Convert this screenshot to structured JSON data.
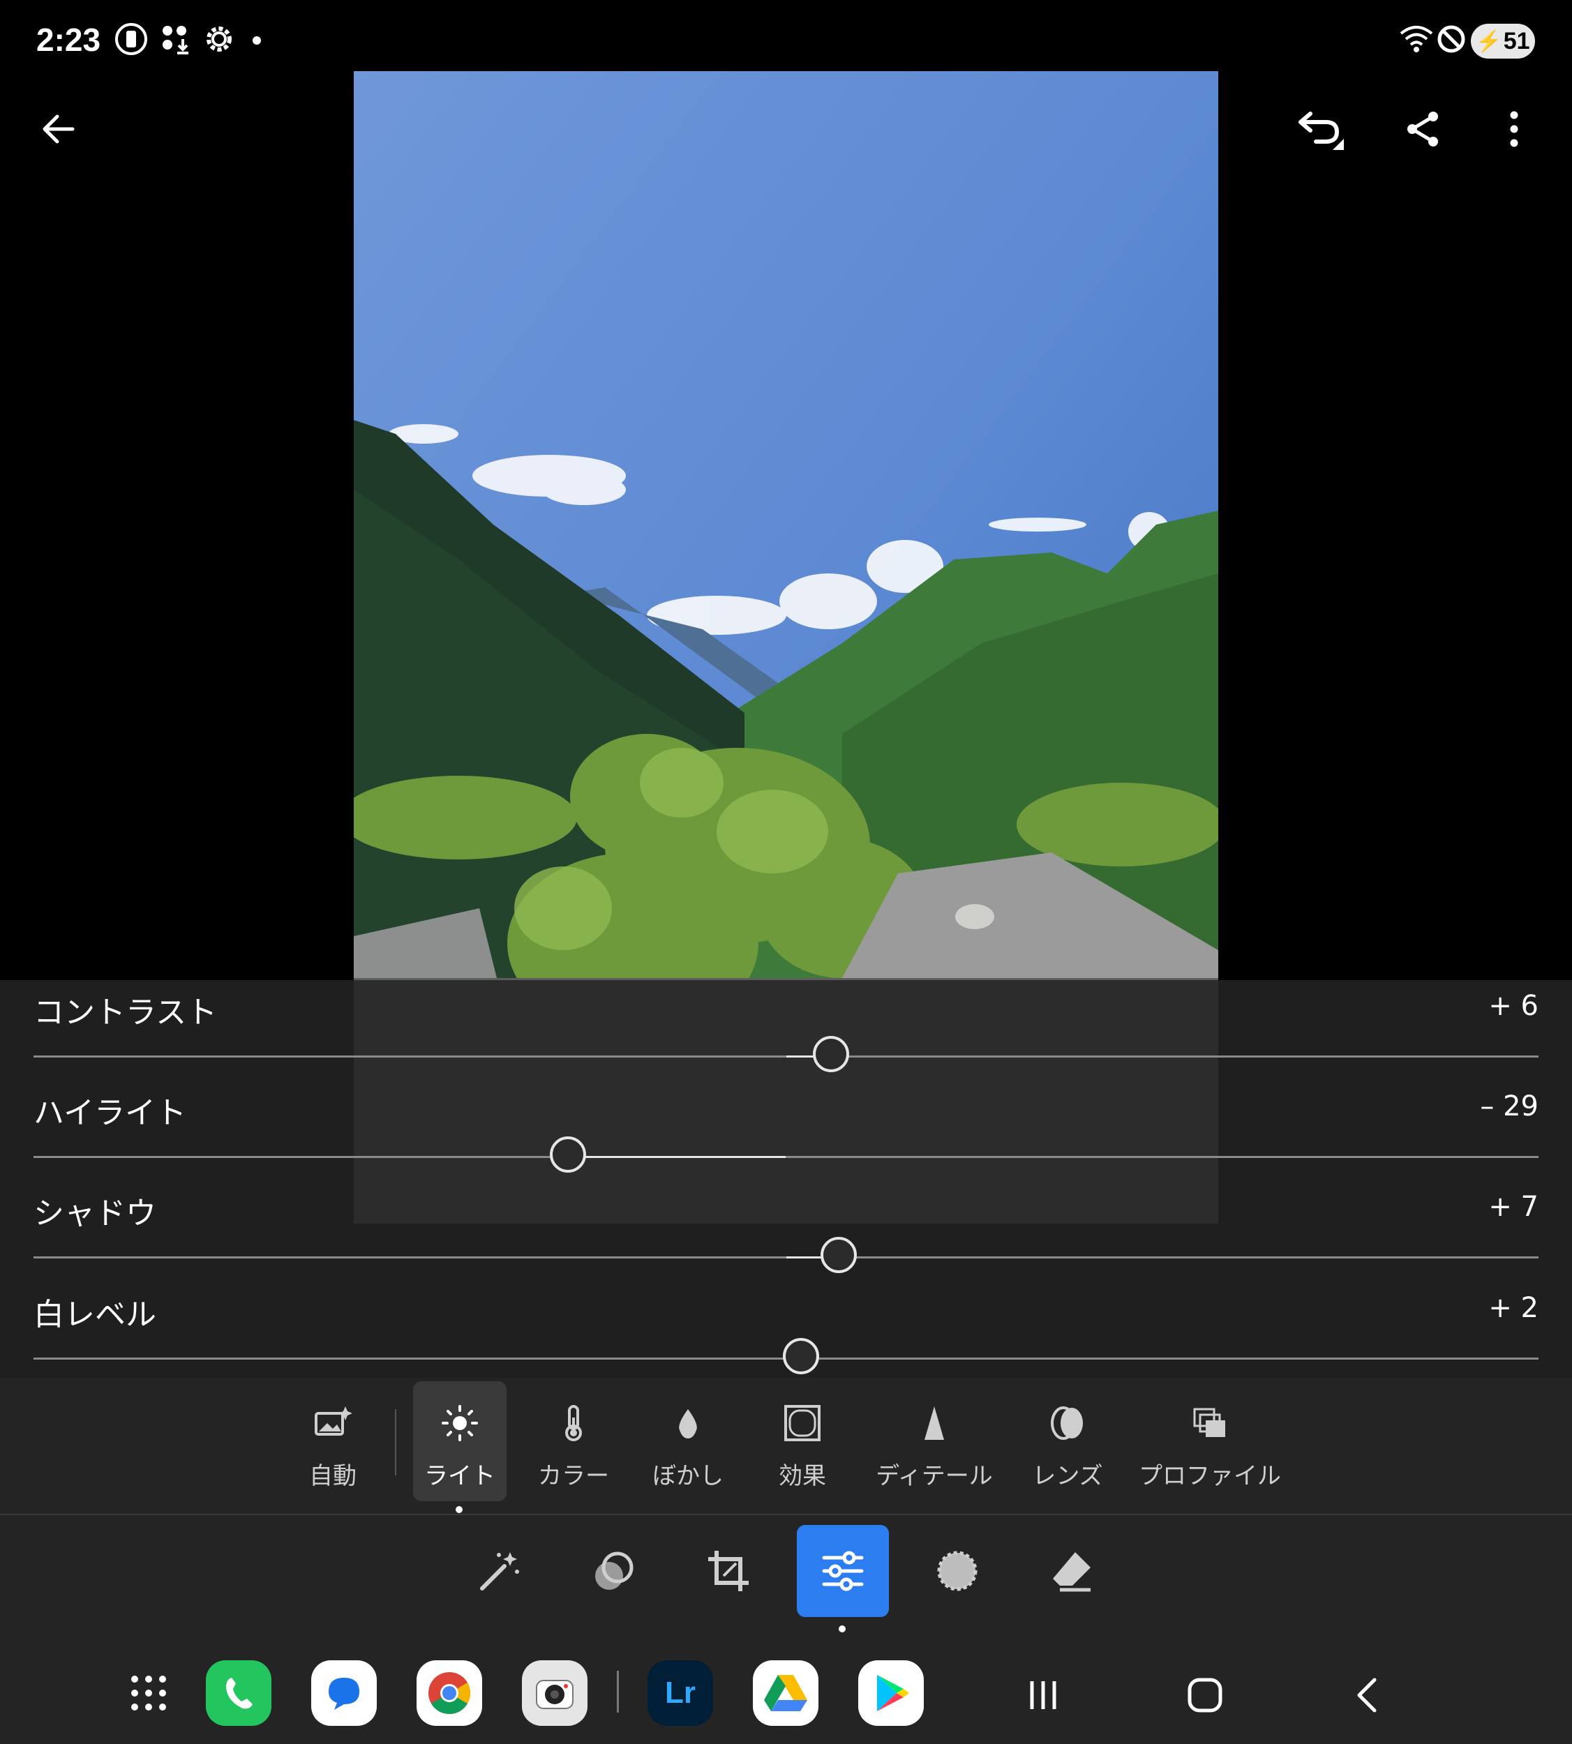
{
  "status_bar": {
    "time": "2:23",
    "battery": "51"
  },
  "photo": {
    "alt": "mountain river landscape"
  },
  "sliders": [
    {
      "label": "コントラスト",
      "value": "+ 6",
      "amount": 6
    },
    {
      "label": "ハイライト",
      "value": "– 29",
      "amount": -29
    },
    {
      "label": "シャドウ",
      "value": "+ 7",
      "amount": 7
    },
    {
      "label": "白レベル",
      "value": "+ 2",
      "amount": 2
    }
  ],
  "categories": [
    {
      "label": "自動",
      "icon": "auto-image-icon"
    },
    {
      "label": "ライト",
      "icon": "sun-icon",
      "active": true
    },
    {
      "label": "カラー",
      "icon": "thermometer-icon"
    },
    {
      "label": "ぼかし",
      "icon": "droplet-icon"
    },
    {
      "label": "効果",
      "icon": "vignette-icon"
    },
    {
      "label": "ディテール",
      "icon": "triangle-icon"
    },
    {
      "label": "レンズ",
      "icon": "lens-icon"
    },
    {
      "label": "プロファイル",
      "icon": "profile-icon"
    }
  ],
  "tools": [
    {
      "name": "magic-wand-icon"
    },
    {
      "name": "presets-icon"
    },
    {
      "name": "crop-icon"
    },
    {
      "name": "adjust-sliders-icon",
      "active": true
    },
    {
      "name": "masking-icon"
    },
    {
      "name": "eraser-icon"
    }
  ],
  "dock": {
    "apps": [
      "app-drawer",
      "phone",
      "messages",
      "chrome",
      "camera",
      "lightroom",
      "drive",
      "play-store"
    ],
    "lightroom_label": "Lr"
  },
  "colors": {
    "accent": "#2c7df0",
    "panel": "#242424",
    "phone_green": "#22c55e",
    "lightroom_navy": "#001e36"
  }
}
